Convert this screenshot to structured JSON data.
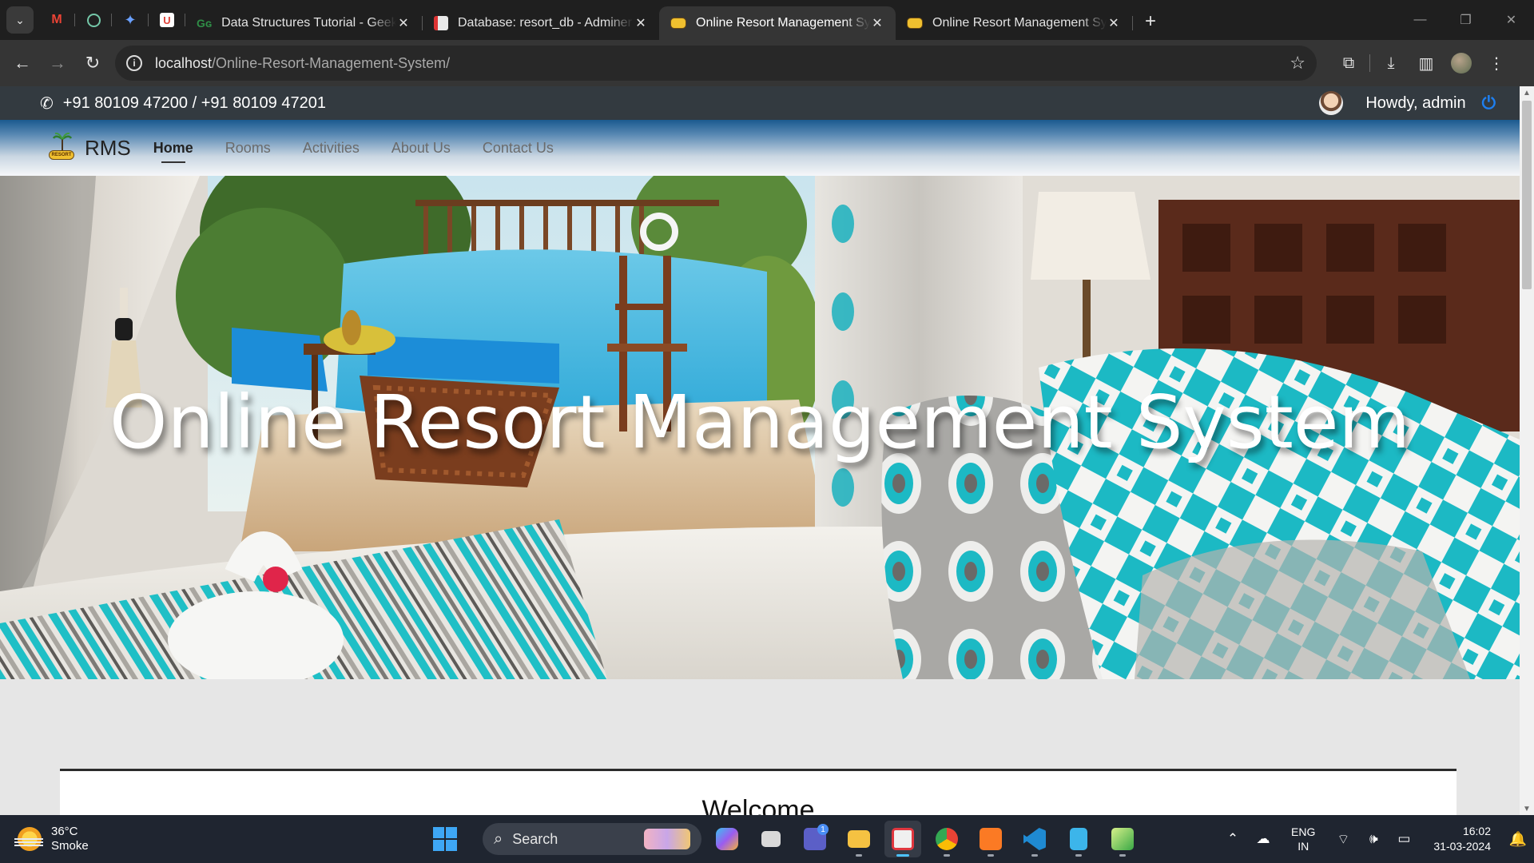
{
  "browser": {
    "tabs": [
      {
        "title": "Data Structures Tutorial - GeeksforGeeks",
        "favicon": "gfg-icon",
        "active": false
      },
      {
        "title": "Database: resort_db - Adminer",
        "favicon": "adminer-icon",
        "active": false
      },
      {
        "title": "Online Resort Management System",
        "favicon": "resort-icon",
        "active": true
      },
      {
        "title": "Online Resort Management System",
        "favicon": "resort-icon",
        "active": false
      }
    ],
    "pinned": [
      "gmail-icon",
      "chatgpt-icon",
      "gemini-icon",
      "pocket-icon"
    ],
    "url_host": "localhost",
    "url_path": "/Online-Resort-Management-System/"
  },
  "site": {
    "contact": "+91 80109 47200 / +91 80109 47201",
    "greeting": "Howdy, admin",
    "brand": "RMS",
    "logo_badge": "RESORT",
    "nav": [
      {
        "label": "Home",
        "active": true
      },
      {
        "label": "Rooms",
        "active": false
      },
      {
        "label": "Activities",
        "active": false
      },
      {
        "label": "About Us",
        "active": false
      },
      {
        "label": "Contact Us",
        "active": false
      }
    ],
    "hero_title": "Online Resort Management System",
    "welcome_heading": "Welcome"
  },
  "taskbar": {
    "temperature": "36°C",
    "condition": "Smoke",
    "search_placeholder": "Search",
    "lang_top": "ENG",
    "lang_bottom": "IN",
    "time": "16:02",
    "date": "31-03-2024",
    "teams_badge": "1"
  },
  "colors": {
    "topbar": "#333a40",
    "nav_gradient_top": "#1b5a8f",
    "power_icon": "#1e7ff0",
    "pool": "#2fa9d8",
    "turquoise": "#1fbfc6"
  }
}
